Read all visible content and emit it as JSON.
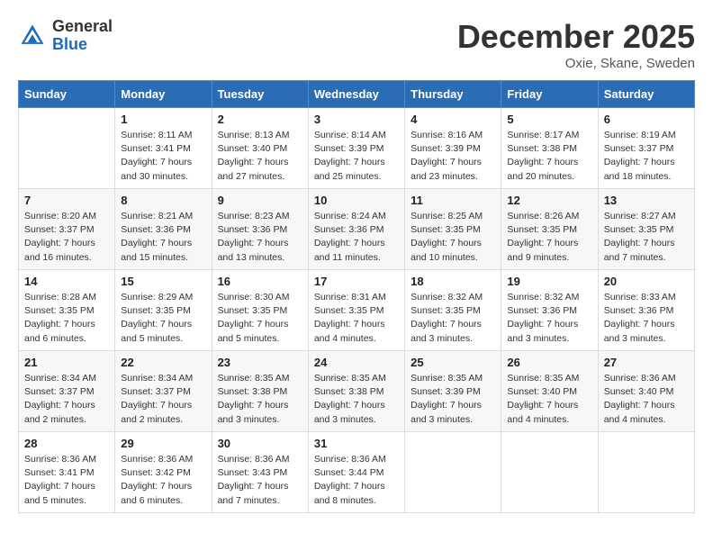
{
  "header": {
    "logo_general": "General",
    "logo_blue": "Blue",
    "month_title": "December 2025",
    "location": "Oxie, Skane, Sweden"
  },
  "days_of_week": [
    "Sunday",
    "Monday",
    "Tuesday",
    "Wednesday",
    "Thursday",
    "Friday",
    "Saturday"
  ],
  "weeks": [
    [
      {
        "day": "",
        "info": ""
      },
      {
        "day": "1",
        "info": "Sunrise: 8:11 AM\nSunset: 3:41 PM\nDaylight: 7 hours\nand 30 minutes."
      },
      {
        "day": "2",
        "info": "Sunrise: 8:13 AM\nSunset: 3:40 PM\nDaylight: 7 hours\nand 27 minutes."
      },
      {
        "day": "3",
        "info": "Sunrise: 8:14 AM\nSunset: 3:39 PM\nDaylight: 7 hours\nand 25 minutes."
      },
      {
        "day": "4",
        "info": "Sunrise: 8:16 AM\nSunset: 3:39 PM\nDaylight: 7 hours\nand 23 minutes."
      },
      {
        "day": "5",
        "info": "Sunrise: 8:17 AM\nSunset: 3:38 PM\nDaylight: 7 hours\nand 20 minutes."
      },
      {
        "day": "6",
        "info": "Sunrise: 8:19 AM\nSunset: 3:37 PM\nDaylight: 7 hours\nand 18 minutes."
      }
    ],
    [
      {
        "day": "7",
        "info": "Sunrise: 8:20 AM\nSunset: 3:37 PM\nDaylight: 7 hours\nand 16 minutes."
      },
      {
        "day": "8",
        "info": "Sunrise: 8:21 AM\nSunset: 3:36 PM\nDaylight: 7 hours\nand 15 minutes."
      },
      {
        "day": "9",
        "info": "Sunrise: 8:23 AM\nSunset: 3:36 PM\nDaylight: 7 hours\nand 13 minutes."
      },
      {
        "day": "10",
        "info": "Sunrise: 8:24 AM\nSunset: 3:36 PM\nDaylight: 7 hours\nand 11 minutes."
      },
      {
        "day": "11",
        "info": "Sunrise: 8:25 AM\nSunset: 3:35 PM\nDaylight: 7 hours\nand 10 minutes."
      },
      {
        "day": "12",
        "info": "Sunrise: 8:26 AM\nSunset: 3:35 PM\nDaylight: 7 hours\nand 9 minutes."
      },
      {
        "day": "13",
        "info": "Sunrise: 8:27 AM\nSunset: 3:35 PM\nDaylight: 7 hours\nand 7 minutes."
      }
    ],
    [
      {
        "day": "14",
        "info": "Sunrise: 8:28 AM\nSunset: 3:35 PM\nDaylight: 7 hours\nand 6 minutes."
      },
      {
        "day": "15",
        "info": "Sunrise: 8:29 AM\nSunset: 3:35 PM\nDaylight: 7 hours\nand 5 minutes."
      },
      {
        "day": "16",
        "info": "Sunrise: 8:30 AM\nSunset: 3:35 PM\nDaylight: 7 hours\nand 5 minutes."
      },
      {
        "day": "17",
        "info": "Sunrise: 8:31 AM\nSunset: 3:35 PM\nDaylight: 7 hours\nand 4 minutes."
      },
      {
        "day": "18",
        "info": "Sunrise: 8:32 AM\nSunset: 3:35 PM\nDaylight: 7 hours\nand 3 minutes."
      },
      {
        "day": "19",
        "info": "Sunrise: 8:32 AM\nSunset: 3:36 PM\nDaylight: 7 hours\nand 3 minutes."
      },
      {
        "day": "20",
        "info": "Sunrise: 8:33 AM\nSunset: 3:36 PM\nDaylight: 7 hours\nand 3 minutes."
      }
    ],
    [
      {
        "day": "21",
        "info": "Sunrise: 8:34 AM\nSunset: 3:37 PM\nDaylight: 7 hours\nand 2 minutes."
      },
      {
        "day": "22",
        "info": "Sunrise: 8:34 AM\nSunset: 3:37 PM\nDaylight: 7 hours\nand 2 minutes."
      },
      {
        "day": "23",
        "info": "Sunrise: 8:35 AM\nSunset: 3:38 PM\nDaylight: 7 hours\nand 3 minutes."
      },
      {
        "day": "24",
        "info": "Sunrise: 8:35 AM\nSunset: 3:38 PM\nDaylight: 7 hours\nand 3 minutes."
      },
      {
        "day": "25",
        "info": "Sunrise: 8:35 AM\nSunset: 3:39 PM\nDaylight: 7 hours\nand 3 minutes."
      },
      {
        "day": "26",
        "info": "Sunrise: 8:35 AM\nSunset: 3:40 PM\nDaylight: 7 hours\nand 4 minutes."
      },
      {
        "day": "27",
        "info": "Sunrise: 8:36 AM\nSunset: 3:40 PM\nDaylight: 7 hours\nand 4 minutes."
      }
    ],
    [
      {
        "day": "28",
        "info": "Sunrise: 8:36 AM\nSunset: 3:41 PM\nDaylight: 7 hours\nand 5 minutes."
      },
      {
        "day": "29",
        "info": "Sunrise: 8:36 AM\nSunset: 3:42 PM\nDaylight: 7 hours\nand 6 minutes."
      },
      {
        "day": "30",
        "info": "Sunrise: 8:36 AM\nSunset: 3:43 PM\nDaylight: 7 hours\nand 7 minutes."
      },
      {
        "day": "31",
        "info": "Sunrise: 8:36 AM\nSunset: 3:44 PM\nDaylight: 7 hours\nand 8 minutes."
      },
      {
        "day": "",
        "info": ""
      },
      {
        "day": "",
        "info": ""
      },
      {
        "day": "",
        "info": ""
      }
    ]
  ]
}
